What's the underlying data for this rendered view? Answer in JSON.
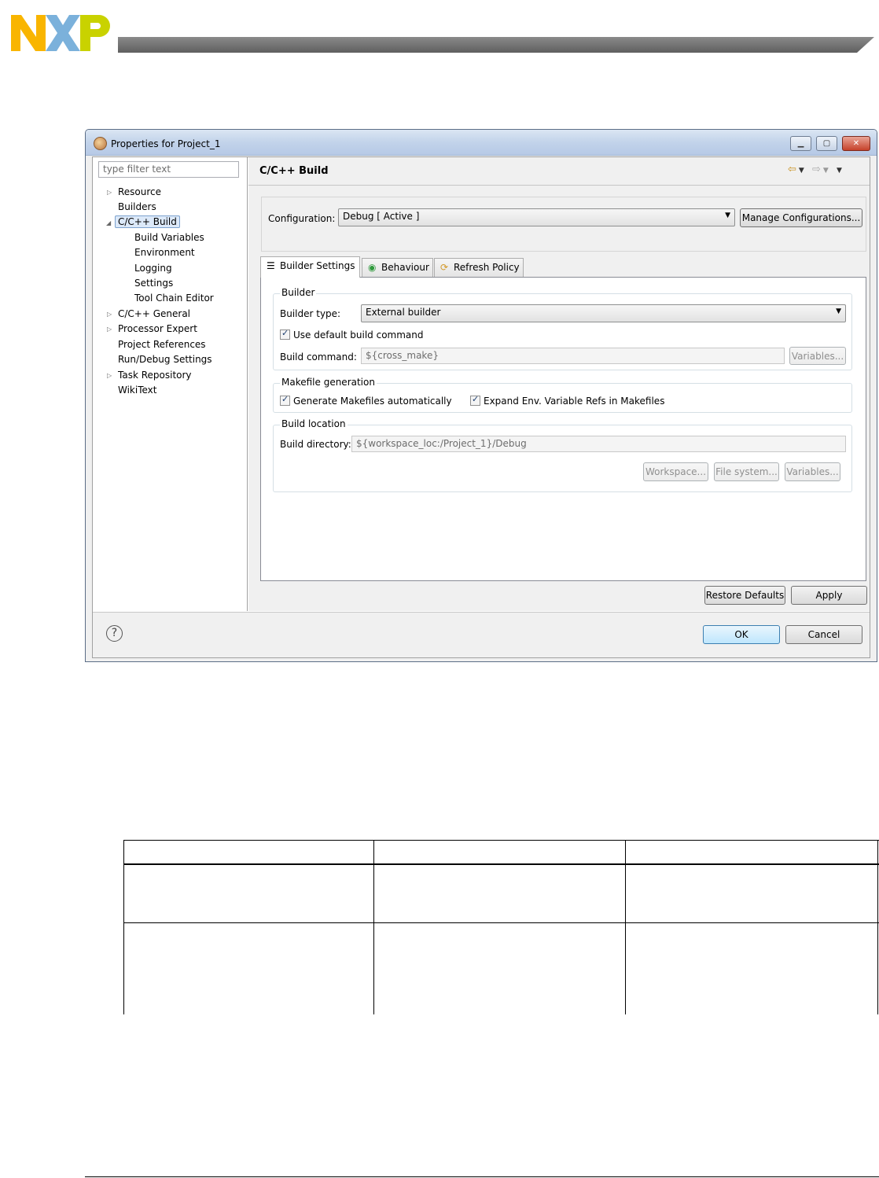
{
  "window": {
    "title": "Properties for Project_1",
    "controls": [
      "▁",
      "▢",
      "✕"
    ]
  },
  "filter": {
    "placeholder": "type filter text"
  },
  "tree": [
    {
      "label": "Resource",
      "arrow": "▷"
    },
    {
      "label": "Builders"
    },
    {
      "label": "C/C++ Build",
      "arrow": "◢",
      "selected": true
    },
    {
      "label": "Build Variables"
    },
    {
      "label": "Environment"
    },
    {
      "label": "Logging"
    },
    {
      "label": "Settings"
    },
    {
      "label": "Tool Chain Editor"
    },
    {
      "label": "C/C++ General",
      "arrow": "▷"
    },
    {
      "label": "Processor Expert",
      "arrow": "▷"
    },
    {
      "label": "Project References"
    },
    {
      "label": "Run/Debug Settings"
    },
    {
      "label": "Task Repository",
      "arrow": "▷"
    },
    {
      "label": "WikiText"
    }
  ],
  "page": {
    "title": "C/C++ Build",
    "configuration_label": "Configuration:",
    "configuration_value": "Debug  [ Active ]",
    "manage_button": "Manage Configurations..."
  },
  "tabs": [
    {
      "label": "Builder Settings",
      "icon": "list-icon",
      "active": true
    },
    {
      "label": "Behaviour",
      "icon": "radio-icon"
    },
    {
      "label": "Refresh Policy",
      "icon": "refresh-icon"
    }
  ],
  "builder": {
    "group_label": "Builder",
    "type_label": "Builder type:",
    "type_value": "External builder",
    "use_default_label": "Use default build command",
    "command_label": "Build command:",
    "command_value": "${cross_make}",
    "variables_button": "Variables..."
  },
  "makefile": {
    "group_label": "Makefile generation",
    "generate_label": "Generate Makefiles automatically",
    "expand_label": "Expand Env. Variable Refs in Makefiles"
  },
  "location": {
    "group_label": "Build location",
    "directory_label": "Build directory:",
    "directory_value": "${workspace_loc:/Project_1}/Debug",
    "workspace_button": "Workspace...",
    "filesystem_button": "File system...",
    "variables_button": "Variables..."
  },
  "buttons": {
    "restore_defaults": "Restore Defaults",
    "apply": "Apply",
    "ok": "OK",
    "cancel": "Cancel"
  },
  "colors": {
    "nxp_yellow": "#f9b500",
    "nxp_blue": "#7bb1db",
    "nxp_green": "#c9d200"
  }
}
